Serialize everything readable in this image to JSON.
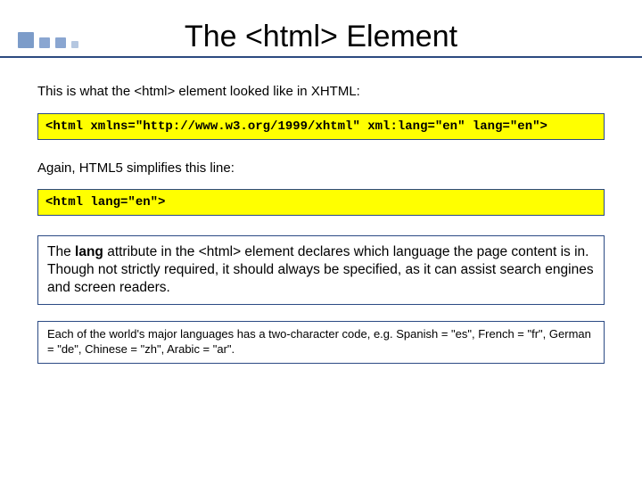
{
  "title": "The <html> Element",
  "intro": "This is what the <html> element looked like in XHTML:",
  "code_xhtml": "<html xmlns=\"http://www.w3.org/1999/xhtml\" xml:lang=\"en\" lang=\"en\">",
  "simplify_text": "Again, HTML5 simplifies this line:",
  "code_html5": "<html lang=\"en\">",
  "lang_box_prefix": "The ",
  "lang_box_bold": "lang",
  "lang_box_rest": " attribute in the <html> element declares which language the page content is in.  Though not strictly required, it should always be specified, as it can assist search engines and screen readers.",
  "codes_note": "Each of the world's major languages has a two-character code, e.g. Spanish = \"es\", French = \"fr\", German = \"de\", Chinese = \"zh\", Arabic = \"ar\"."
}
